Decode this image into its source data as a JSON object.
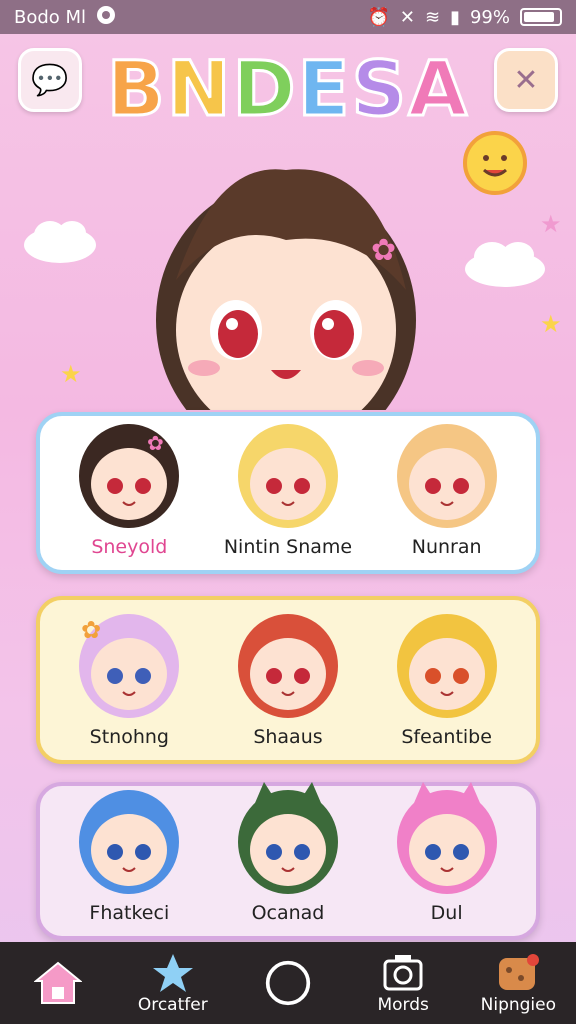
{
  "status": {
    "left_text": "Bodo Ml",
    "battery": "99%",
    "icons": [
      "search-icon",
      "alarm-icon",
      "no-signal-icon",
      "wifi-icon",
      "signal-icon",
      "battery-icon"
    ]
  },
  "header": {
    "title_letters": [
      "B",
      "N",
      "D",
      "E",
      "S",
      "A"
    ],
    "left_button_icon": "chat-bubble-icon",
    "right_button_icon": "close-icon"
  },
  "rows": [
    {
      "theme": "blue",
      "characters": [
        {
          "name": "Sneyold"
        },
        {
          "name": "Nintin Sname"
        },
        {
          "name": "Nunran"
        }
      ]
    },
    {
      "theme": "yellow",
      "characters": [
        {
          "name": "Stnohng"
        },
        {
          "name": "Shaaus"
        },
        {
          "name": "Sfeantibe"
        }
      ]
    },
    {
      "theme": "purple",
      "characters": [
        {
          "name": "Fhatkeci"
        },
        {
          "name": "Ocanad"
        },
        {
          "name": "Dul"
        }
      ]
    }
  ],
  "nav": [
    {
      "label": "",
      "icon": "home-icon"
    },
    {
      "label": "Orcatfer",
      "icon": "star-icon"
    },
    {
      "label": "",
      "icon": "circle-icon"
    },
    {
      "label": "Mords",
      "icon": "camera-icon"
    },
    {
      "label": "Nipngieo",
      "icon": "cookie-icon"
    }
  ]
}
